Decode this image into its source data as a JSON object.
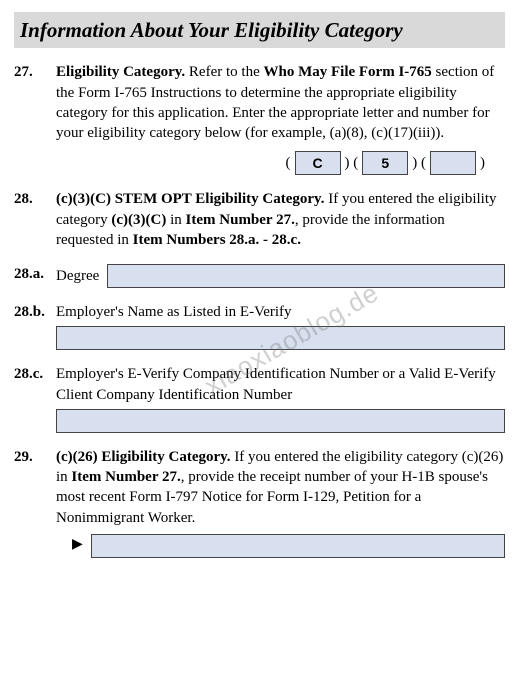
{
  "section_title": "Information About Your Eligibility Category",
  "watermark": "xiaoxiaoblog.de",
  "q27": {
    "num": "27.",
    "lead": "Eligibility Category.",
    "text1": "  Refer to the ",
    "bold2": "Who May File Form I-765",
    "text2": " section of the Form I-765 Instructions to determine the appropriate eligibility category for this application. Enter the appropriate letter and number for your eligibility category below (for example, (a)(8), (c)(17)(iii)).",
    "field1": "C",
    "field2": "5",
    "field3": ""
  },
  "q28": {
    "num": "28.",
    "lead": "(c)(3)(C) STEM OPT Eligibility Category.",
    "text1": "  If you entered the eligibility category ",
    "bold2": "(c)(3)(C)",
    "text2": " in ",
    "bold3": "Item Number 27.",
    "text3": ", provide the information requested in ",
    "bold4": "Item Numbers 28.a. - 28.c."
  },
  "q28a": {
    "num": "28.a.",
    "label": "Degree",
    "value": ""
  },
  "q28b": {
    "num": "28.b.",
    "label": "Employer's Name as Listed in E-Verify",
    "value": ""
  },
  "q28c": {
    "num": "28.c.",
    "label": "Employer's E-Verify Company Identification Number or a Valid E-Verify Client Company Identification Number",
    "value": ""
  },
  "q29": {
    "num": "29.",
    "lead": "(c)(26) Eligibility Category.",
    "text1": "  If you entered the eligibility category (c)(26) in ",
    "bold2": "Item Number 27.",
    "text2": ", provide the receipt number of your H-1B spouse's most recent Form I-797 Notice for Form I-129, Petition for a Nonimmigrant Worker.",
    "value": ""
  }
}
